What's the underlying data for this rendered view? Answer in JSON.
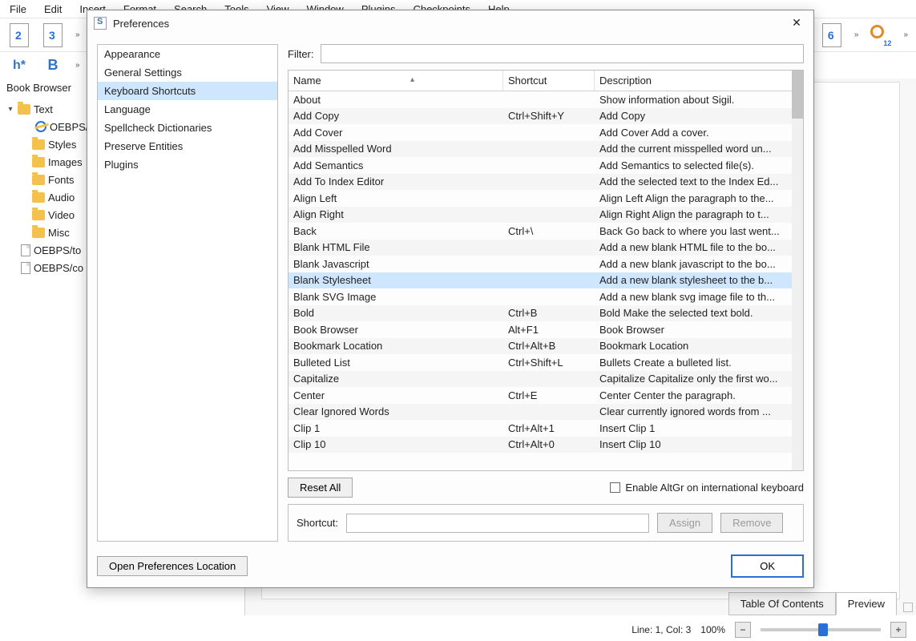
{
  "menu": [
    "File",
    "Edit",
    "Insert",
    "Format",
    "Search",
    "Tools",
    "View",
    "Window",
    "Plugins",
    "Checkpoints",
    "Help"
  ],
  "book_browser": {
    "title": "Book Browser",
    "tree": [
      {
        "type": "folder",
        "label": "Text",
        "indent": 0,
        "expanded": true
      },
      {
        "type": "iefile",
        "label": "OEBPS/T",
        "indent": 2
      },
      {
        "type": "folder",
        "label": "Styles",
        "indent": 1
      },
      {
        "type": "folder",
        "label": "Images",
        "indent": 1
      },
      {
        "type": "folder",
        "label": "Fonts",
        "indent": 1
      },
      {
        "type": "folder",
        "label": "Audio",
        "indent": 1
      },
      {
        "type": "folder",
        "label": "Video",
        "indent": 1
      },
      {
        "type": "folder",
        "label": "Misc",
        "indent": 1
      },
      {
        "type": "file",
        "label": "OEBPS/to",
        "indent": 1
      },
      {
        "type": "file",
        "label": "OEBPS/co",
        "indent": 1
      }
    ]
  },
  "dialog": {
    "title": "Preferences",
    "categories": [
      "Appearance",
      "General Settings",
      "Keyboard Shortcuts",
      "Language",
      "Spellcheck Dictionaries",
      "Preserve Entities",
      "Plugins"
    ],
    "selected_category": "Keyboard Shortcuts",
    "filter_label": "Filter:",
    "filter_value": "",
    "columns": [
      "Name",
      "Shortcut",
      "Description"
    ],
    "rows": [
      {
        "name": "About",
        "shortcut": "",
        "desc": "Show information about Sigil."
      },
      {
        "name": "Add Copy",
        "shortcut": "Ctrl+Shift+Y",
        "desc": "Add Copy"
      },
      {
        "name": "Add Cover",
        "shortcut": "",
        "desc": "Add Cover Add a cover."
      },
      {
        "name": "Add Misspelled Word",
        "shortcut": "",
        "desc": "Add the current misspelled word un..."
      },
      {
        "name": "Add Semantics",
        "shortcut": "",
        "desc": "Add Semantics to selected file(s)."
      },
      {
        "name": "Add To Index Editor",
        "shortcut": "",
        "desc": "Add the selected text to the Index Ed..."
      },
      {
        "name": "Align Left",
        "shortcut": "",
        "desc": "Align Left Align the paragraph to the..."
      },
      {
        "name": "Align Right",
        "shortcut": "",
        "desc": "Align Right Align the paragraph to t..."
      },
      {
        "name": "Back",
        "shortcut": "Ctrl+\\",
        "desc": "Back Go back to where you last went..."
      },
      {
        "name": "Blank HTML File",
        "shortcut": "",
        "desc": "Add a new blank HTML file to the bo..."
      },
      {
        "name": "Blank Javascript",
        "shortcut": "",
        "desc": "Add a new blank javascript to the bo..."
      },
      {
        "name": "Blank Stylesheet",
        "shortcut": "",
        "desc": "Add a new blank stylesheet to the b...",
        "selected": true
      },
      {
        "name": "Blank SVG Image",
        "shortcut": "",
        "desc": "Add a new blank svg image file to th..."
      },
      {
        "name": "Bold",
        "shortcut": "Ctrl+B",
        "desc": "Bold Make the selected text bold."
      },
      {
        "name": "Book Browser",
        "shortcut": "Alt+F1",
        "desc": "Book Browser"
      },
      {
        "name": "Bookmark Location",
        "shortcut": "Ctrl+Alt+B",
        "desc": "Bookmark Location"
      },
      {
        "name": "Bulleted List",
        "shortcut": "Ctrl+Shift+L",
        "desc": "Bullets Create a bulleted list."
      },
      {
        "name": "Capitalize",
        "shortcut": "",
        "desc": "Capitalize Capitalize only the first wo..."
      },
      {
        "name": "Center",
        "shortcut": "Ctrl+E",
        "desc": "Center Center the paragraph."
      },
      {
        "name": "Clear Ignored Words",
        "shortcut": "",
        "desc": "Clear currently ignored words from ..."
      },
      {
        "name": "Clip 1",
        "shortcut": "Ctrl+Alt+1",
        "desc": "Insert Clip 1"
      },
      {
        "name": "Clip 10",
        "shortcut": "Ctrl+Alt+0",
        "desc": "Insert Clip 10"
      }
    ],
    "reset_all": "Reset All",
    "altgr_label": "Enable AltGr on international keyboard",
    "shortcut_label": "Shortcut:",
    "shortcut_value": "",
    "assign": "Assign",
    "remove": "Remove",
    "open_loc": "Open Preferences Location",
    "ok": "OK"
  },
  "bottom_tabs": {
    "toc": "Table Of Contents",
    "preview": "Preview"
  },
  "status": {
    "position": "Line: 1, Col: 3",
    "zoom": "100%"
  }
}
